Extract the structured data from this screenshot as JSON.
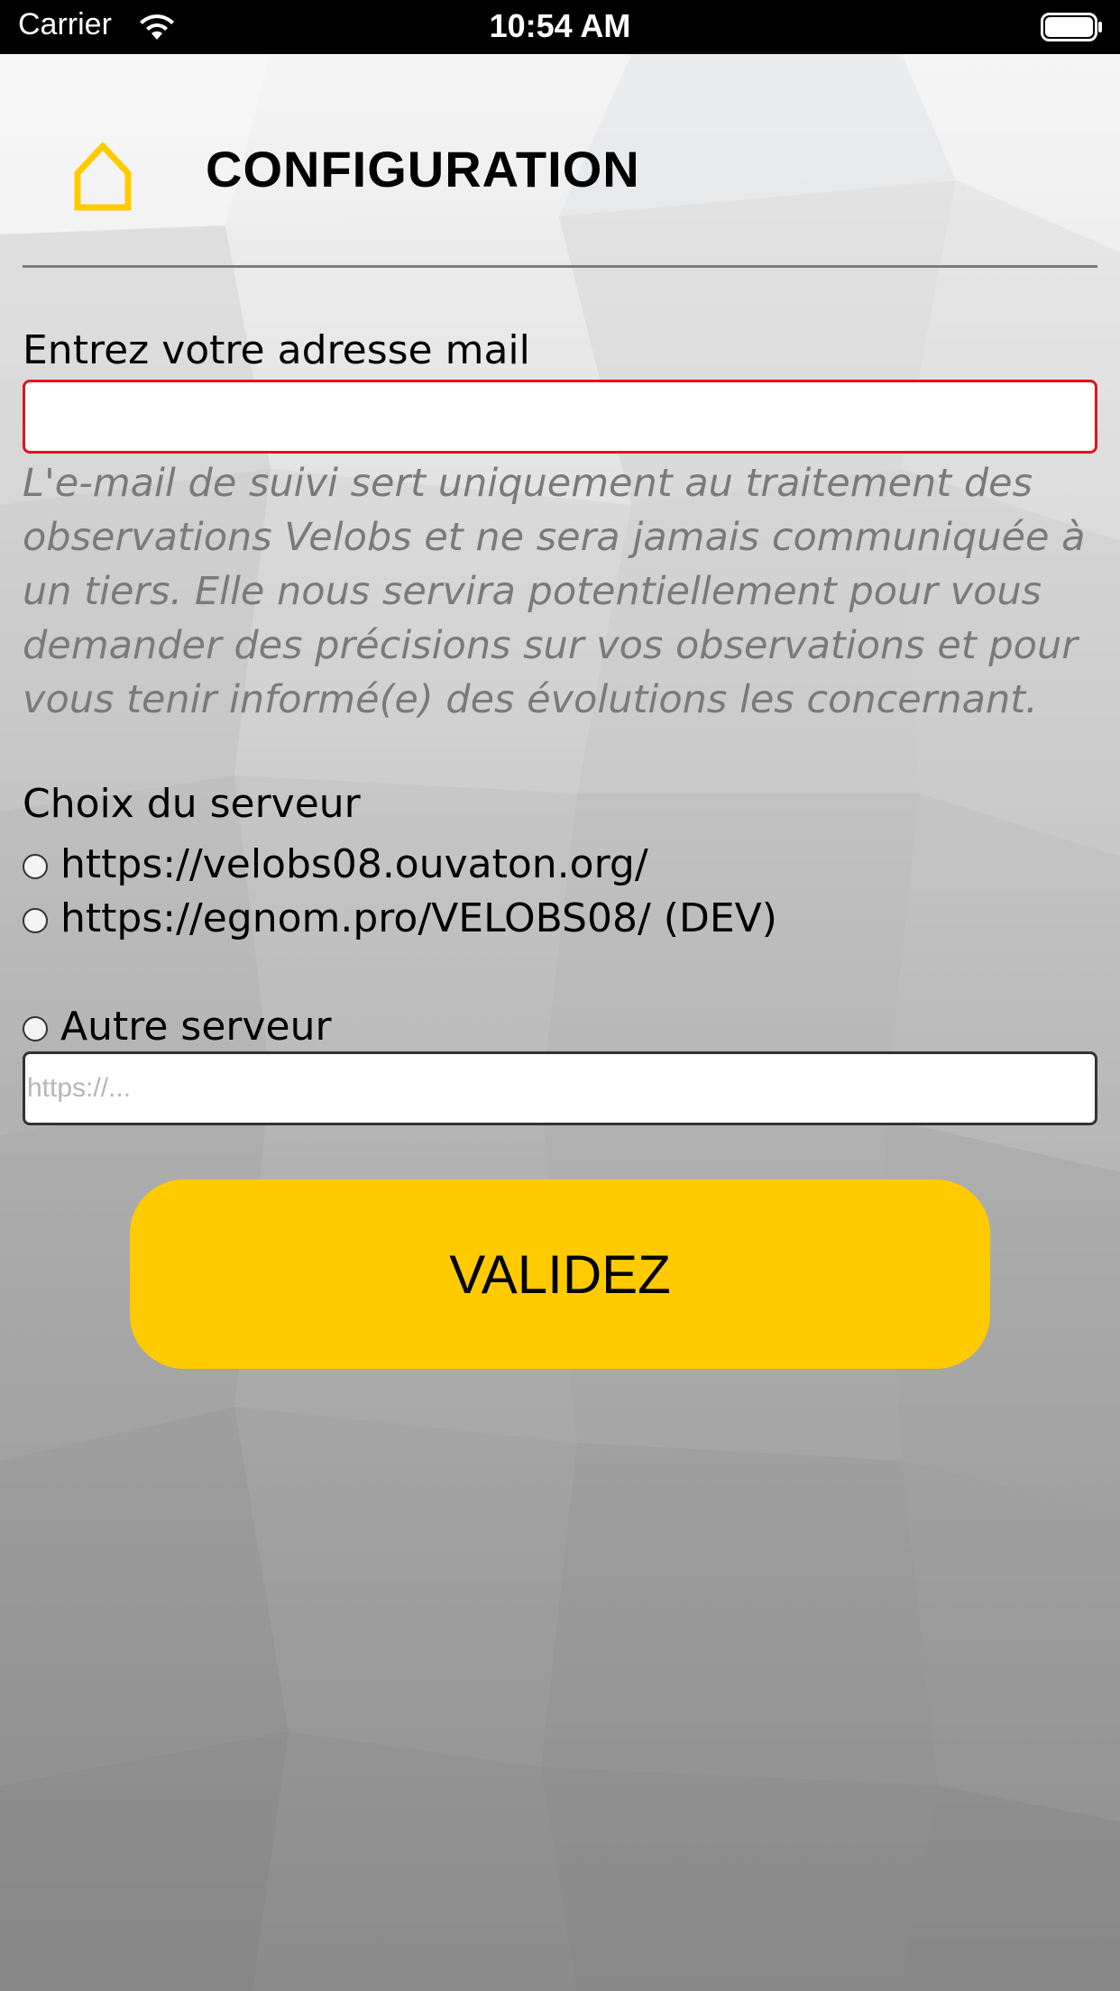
{
  "status_bar": {
    "carrier": "Carrier",
    "time": "10:54 AM"
  },
  "header": {
    "title": "CONFIGURATION",
    "home_icon": "home-icon",
    "accent_color": "#ffcb00"
  },
  "email": {
    "label": "Entrez votre adresse mail",
    "value": "",
    "placeholder": "",
    "border_color": "#e0141e",
    "help_text": "L'e-mail de suivi sert uniquement au traitement des observations Velobs et ne sera jamais communiquée à un tiers. Elle nous servira potentiellement pour vous demander des précisions sur vos observations et pour vous tenir informé(e) des évolutions les concernant."
  },
  "server": {
    "label": "Choix du serveur",
    "options": [
      {
        "label": "https://velobs08.ouvaton.org/",
        "selected": false
      },
      {
        "label": "https://egnom.pro/VELOBS08/ (DEV)",
        "selected": false
      },
      {
        "label": "Autre serveur",
        "selected": false
      }
    ],
    "other_placeholder": "https://...",
    "other_value": ""
  },
  "actions": {
    "validate_label": "VALIDEZ",
    "button_color": "#ffcb00"
  }
}
